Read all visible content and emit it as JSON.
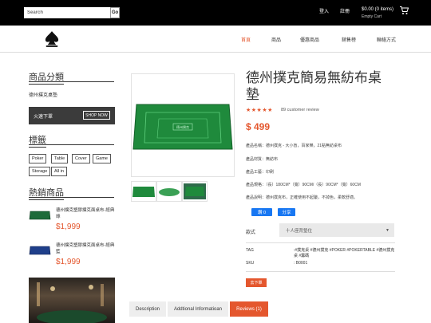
{
  "header": {
    "search_placeholder": "Search",
    "search_button": "Go",
    "login": "登入",
    "register": "註冊",
    "cart_total": "$0.00 (0 items)",
    "cart_status": "Empty Cart"
  },
  "nav": {
    "items": [
      "首頁",
      "商品",
      "優惠商品",
      "銷售榜",
      "聯絡方式"
    ]
  },
  "sidebar": {
    "categories_heading": "商品分類",
    "category_item": "德州撲克桌墊",
    "promo_text": "火速下單",
    "promo_button": "SHOP NOW",
    "tags_heading": "標籤",
    "tags": [
      "Poker",
      "Table",
      "Cover",
      "Game",
      "Storage",
      "All in"
    ],
    "hot_heading": "熱銷商品",
    "hot_items": [
      {
        "name": "德州撲克塑膠撲克面桌布-經典綠",
        "price": "$1,999"
      },
      {
        "name": "德州撲克塑膠撲克面桌布-經典藍",
        "price": "$1,999"
      }
    ]
  },
  "product": {
    "title": "德州撲克簡易無紡布桌墊",
    "stars": "★★★★★",
    "review_count": "89 customer review",
    "price": "$ 499",
    "specs": [
      "產品名稱：德州撲克 - 大小盲，百家樂，21點無紡桌布",
      "產品材質：無紡布",
      "產品工藝：印刷",
      "產品規格：（長）180CM*（寬）90CM/（長）90CM*（寬）60CM",
      "產品說明：德州撲克布，正確使用不起皺，不掉色，柔軟舒適。"
    ],
    "share_like": "讚 0",
    "share_share": "分享",
    "variant_label": "款式",
    "variant_value": "十人座背墊位",
    "meta": [
      {
        "key": "TAG",
        "value": ":#撲克桌 #德州撲克 #POKER #POKERTABLE #德州撲克桌 #籌碼"
      },
      {
        "key": "SKU",
        "value": ": B0001"
      }
    ],
    "qa_button": "去下單",
    "tabs": [
      "Description",
      "Addtional Informatioan",
      "Reviews (1)"
    ],
    "mat_label": "德州撲克"
  },
  "colors": {
    "accent": "#e4572e",
    "topbar": "#000000",
    "felt": "#1f8a3c",
    "facebook": "#1877f2"
  }
}
